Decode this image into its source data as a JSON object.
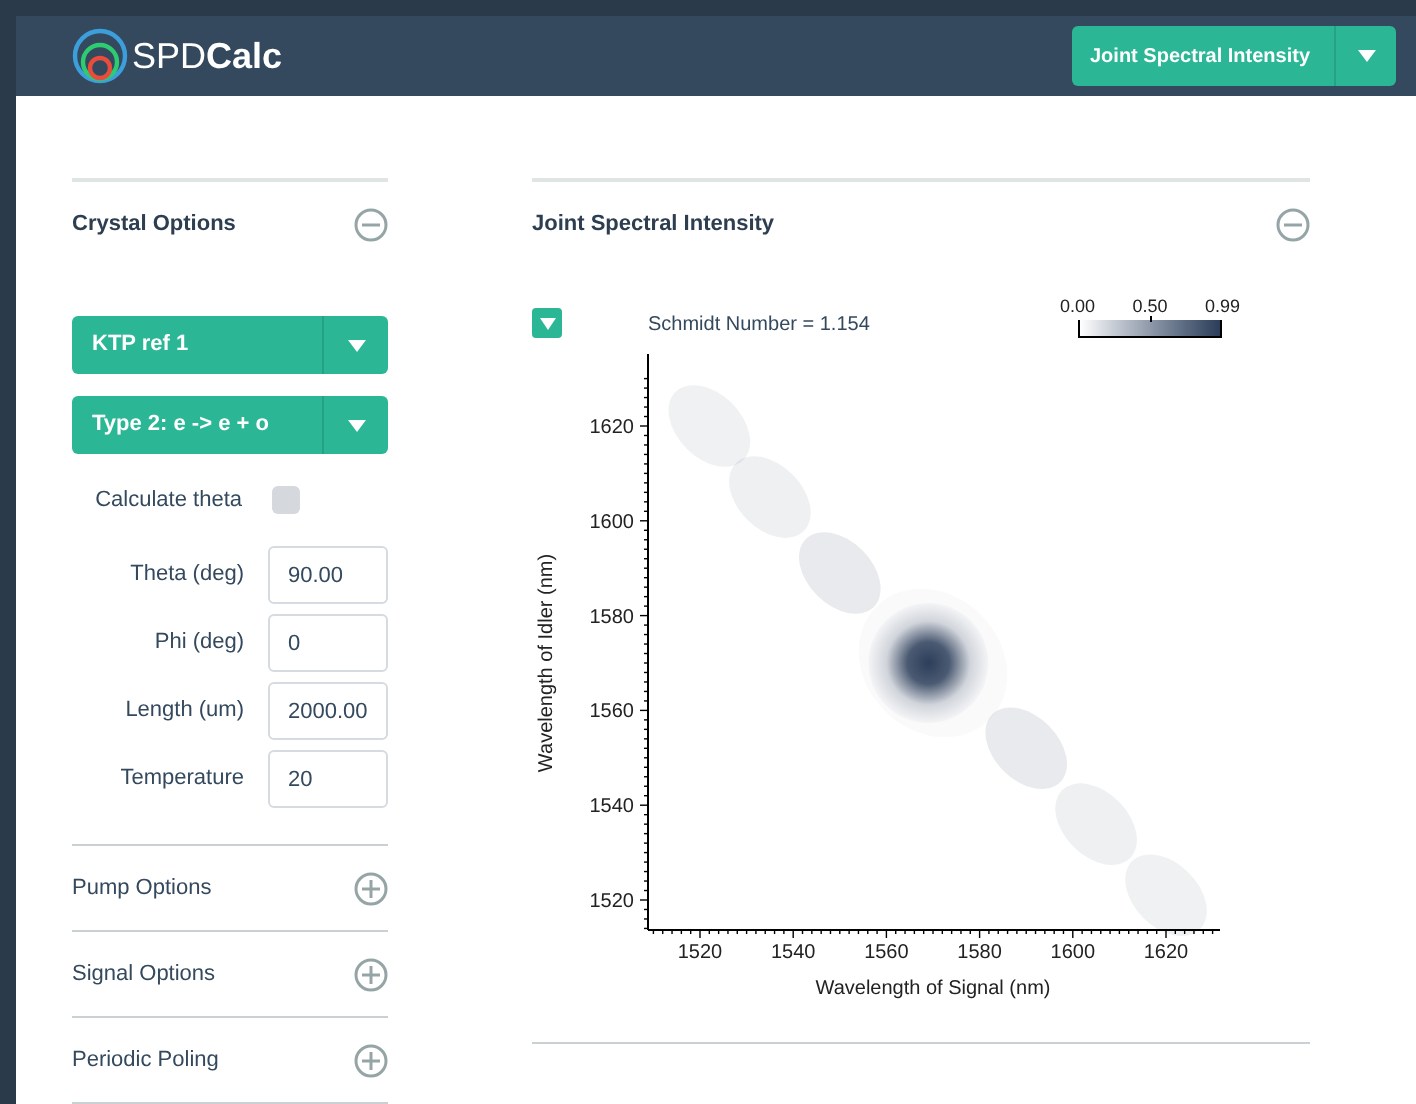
{
  "header": {
    "logo_text": "SPD**Calc**",
    "view_select": {
      "label": "Joint Spectral Intensity"
    }
  },
  "sidebar": {
    "sections": [
      {
        "title": "Crystal Options",
        "expanded": true,
        "selects": [
          {
            "value": "KTP ref 1"
          },
          {
            "value": "Type 2: e -> e + o"
          }
        ],
        "calculate_theta": {
          "label": "Calculate theta",
          "checked": false
        },
        "fields": [
          {
            "label": "Theta (deg)",
            "value": "90.00"
          },
          {
            "label": "Phi (deg)",
            "value": "0"
          },
          {
            "label": "Length (um)",
            "value": "2000.00"
          },
          {
            "label": "Temperature",
            "value": "20"
          }
        ]
      },
      {
        "title": "Pump Options",
        "expanded": false
      },
      {
        "title": "Signal Options",
        "expanded": false
      },
      {
        "title": "Periodic Poling",
        "expanded": false
      }
    ]
  },
  "main": {
    "panel": {
      "title": "Joint Spectral Intensity",
      "expanded": true,
      "plot_options_open": false,
      "schmidt": "Schmidt Number = 1.154",
      "colorbar": {
        "labels": [
          "0.00",
          "0.50",
          "0.99"
        ]
      },
      "plot": {
        "xlabel": "Wavelength of Signal (nm)",
        "ylabel": "Wavelength of Idler (nm)",
        "xticks": [
          "1520",
          "1540",
          "1560",
          "1580",
          "1600",
          "1620"
        ],
        "yticks": [
          "1620",
          "1600",
          "1580",
          "1560",
          "1540",
          "1520"
        ]
      }
    }
  }
}
